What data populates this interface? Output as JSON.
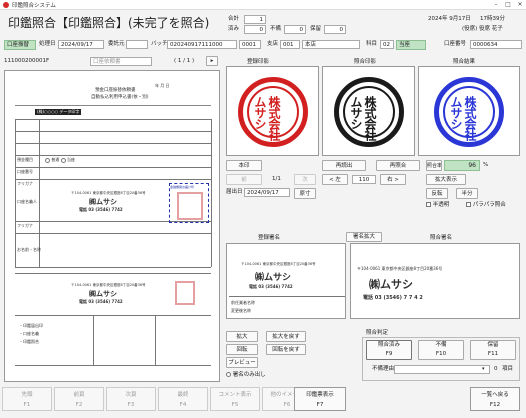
{
  "window": {
    "title": "印鑑照合システム"
  },
  "header": {
    "title": "印鑑照合【印鑑照合】(未完了を照合)",
    "counts": {
      "total_label": "合計",
      "total": "1",
      "completed_label": "済み",
      "completed": "0",
      "mismatch_label": "不備",
      "mismatch": "0",
      "hold_label": "保留",
      "hold": "0"
    },
    "date": "2024年 9月17日",
    "time": "17時39分",
    "user": "(役席) 役席 花子"
  },
  "info": {
    "status": "口座振替",
    "process_date_label": "処理日",
    "process_date": "2024/09/17",
    "consignor_label": "委託元",
    "consignor": "",
    "batch_label": "バッチ",
    "batch": "020240917111000",
    "batch_no": "0001",
    "branch_label": "支店",
    "branch_code": "001",
    "branch_name": "本店",
    "subject_label": "科目",
    "subject_code": "02",
    "subject_name": "当座",
    "account_label": "口座番号",
    "account": "0000634"
  },
  "docbar": {
    "doc_id": "111000200001F",
    "search_placeholder": "口座依頼書",
    "page_text": "( 1 / 1 )"
  },
  "doc": {
    "title1": "預金口座振替依頼書",
    "title2": "自動払込利用申込書(依・別)",
    "date_text": "年  月  日",
    "to_text": "(株)○○○○ データ印字",
    "row1": "預金種目",
    "row2": "口座番号",
    "row3": "フリガナ",
    "row4": "口座名義人",
    "name1": "㈱ムサシ",
    "addr1": "〒104-0061 東京都中央区銀座8丁目20番36号",
    "tel1": "電話 03 (3546) 7742",
    "seal_label": "金融機関お届け印",
    "name2": "㈱ムサシ",
    "addr2": "〒104-0061 東京都中央区銀座8丁目20番36号",
    "tel2": "電話 03 (3546) 7742",
    "row5": "フリガナ",
    "row6": "お名前・名称",
    "notes": [
      "・印鑑届出印",
      "・口座名義",
      "・印鑑照合"
    ]
  },
  "seals": {
    "registered": "登録印影",
    "collated": "照合印影",
    "result": "照合結果",
    "seal_text": "株式会社ムサシ"
  },
  "controls": {
    "hon_in": "本印",
    "prev": "前",
    "page": "1/1",
    "next": "次",
    "rotate_ccw": "< 左",
    "size": "110",
    "rotate_cw": "右 >",
    "registered_date_label": "届出日",
    "registered_date": "2024/09/17",
    "original": "原寸",
    "reread": "再読出",
    "rematch": "再照合",
    "match_rate_label": "照合率",
    "match_rate": "96",
    "match_rate_unit": "%",
    "enlarge_view": "拡大表示",
    "invert": "反転",
    "half": "半分",
    "semi_transparent": "半透明",
    "parapara": "パラパラ照合"
  },
  "signature": {
    "registered_label": "登録署名",
    "collated_label": "照合署名",
    "zoom_label": "署名拡大",
    "addr": "〒104-0061 東京都中央区銀座8丁目20番36号",
    "name": "㈱ムサシ",
    "tel": "電話 03 (3546) 7742",
    "tel_prefix": "電話 03 (3546) 7 7 4 2",
    "before_label": "前任業者名称",
    "change_label": "変更後名称"
  },
  "view_tools": {
    "zoom": "拡大",
    "zoom_restore": "拡大を戻す",
    "rotate": "回転",
    "rotate_restore": "回転を戻す",
    "preview": "プレビュー",
    "show_sig": "署名のみ出し"
  },
  "judgement": {
    "title": "照合判定",
    "match": "照合済み",
    "match_key": "F9",
    "mismatch": "不備",
    "mismatch_key": "F10",
    "hold": "保留",
    "hold_key": "F11",
    "reason_label": "不備理由",
    "reason_value": "",
    "item_count": "0",
    "item_label": "項目"
  },
  "fkeys": [
    {
      "label": "先頭",
      "key": "F1",
      "enabled": false
    },
    {
      "label": "前頁",
      "key": "F2",
      "enabled": false
    },
    {
      "label": "次頁",
      "key": "F3",
      "enabled": false
    },
    {
      "label": "最終",
      "key": "F4",
      "enabled": false
    },
    {
      "label": "コメント表示",
      "key": "F5",
      "enabled": false
    },
    {
      "label": "他のイメージ",
      "key": "F6",
      "enabled": false
    },
    {
      "label": "印鑑票表示",
      "key": "F7",
      "enabled": true
    },
    {
      "label": "一覧へ戻る",
      "key": "F12",
      "enabled": true
    }
  ],
  "colors": {
    "seal_red": "#d21f1f",
    "seal_black": "#1a1a1a",
    "seal_blue": "#2a36d6",
    "status_green": "#bfe3c3",
    "match_rate_bg": "#bfe3c3"
  }
}
